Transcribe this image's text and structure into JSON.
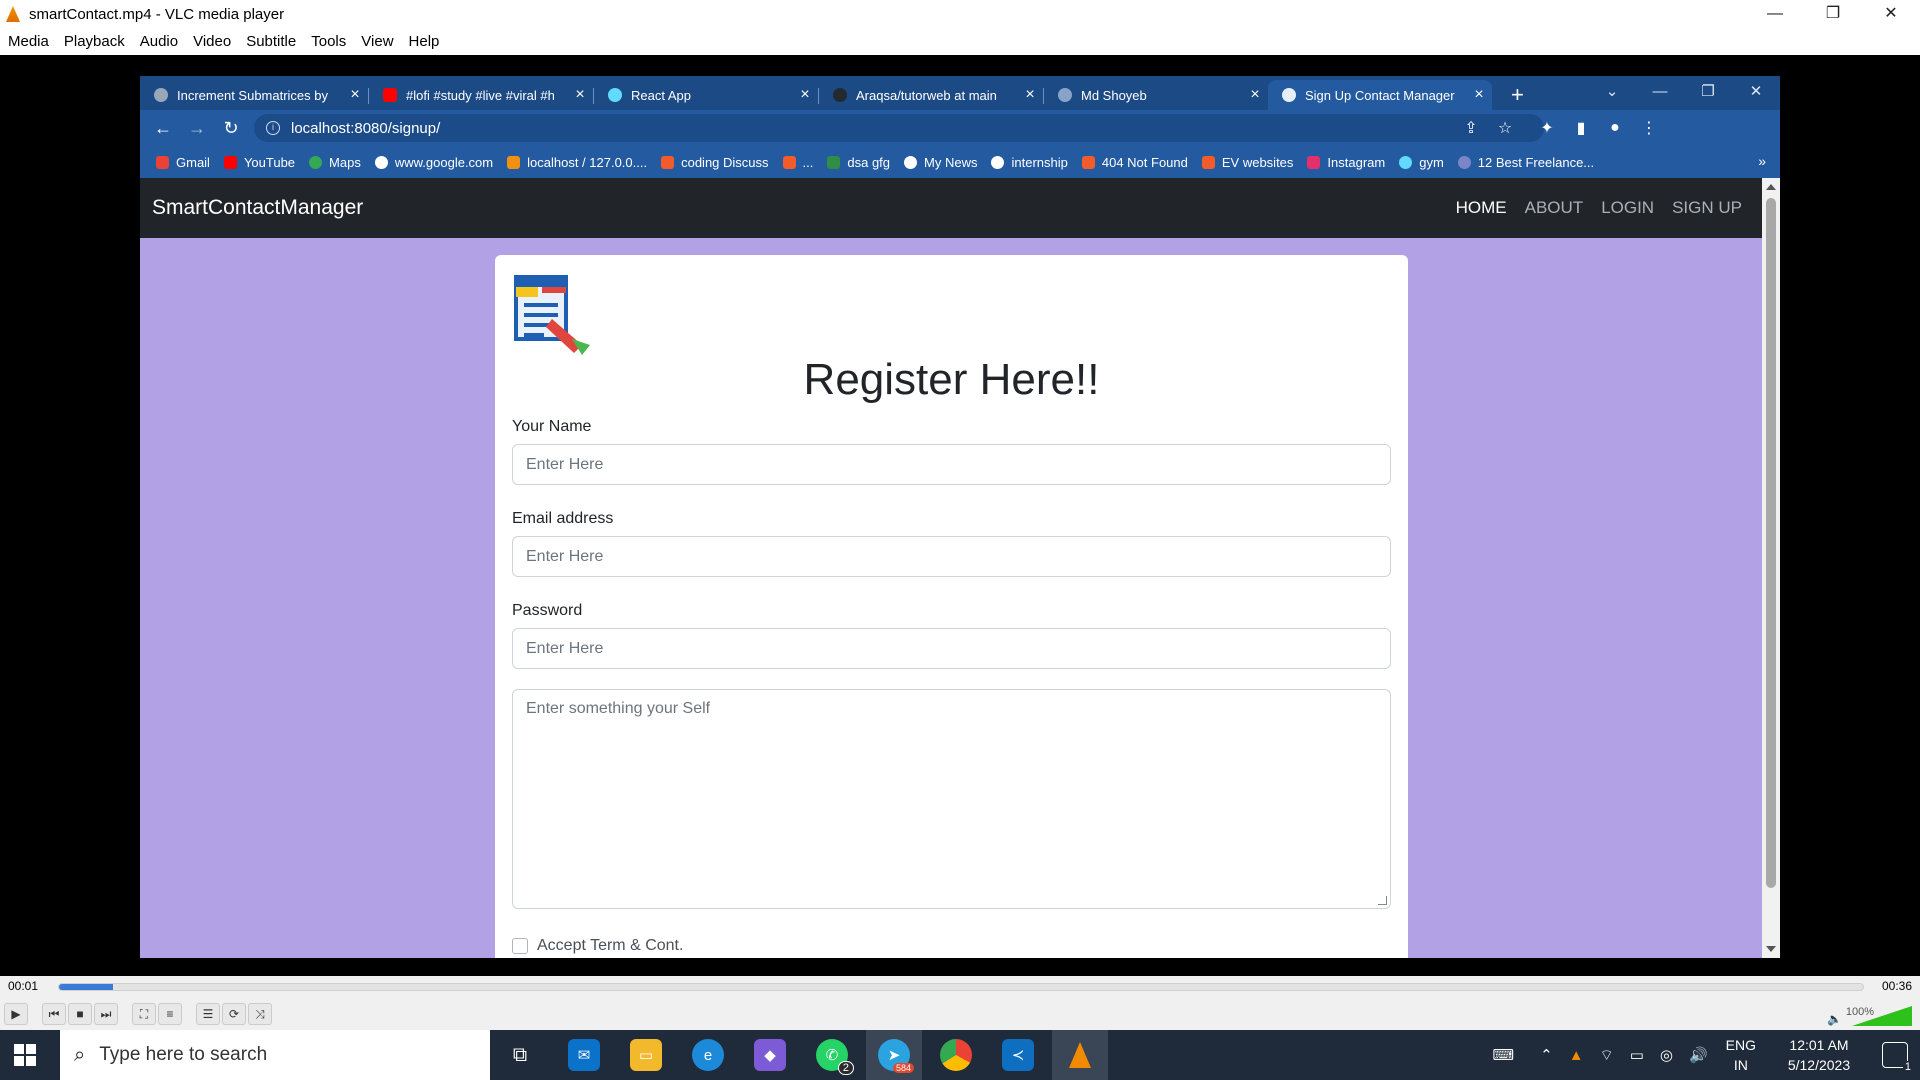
{
  "vlc": {
    "title": "smartContact.mp4 - VLC media player",
    "menu": [
      "Media",
      "Playback",
      "Audio",
      "Video",
      "Subtitle",
      "Tools",
      "View",
      "Help"
    ],
    "time_current": "00:01",
    "time_total": "00:36",
    "progress": 0.03,
    "volume_label": "100%",
    "volume": 1.0
  },
  "browser": {
    "tabs": [
      {
        "label": "Increment Submatrices by",
        "color": "#9aa7b8"
      },
      {
        "label": "#lofi #study #live #viral #h",
        "color": "#ff0000"
      },
      {
        "label": "React App",
        "color": "#61dafb"
      },
      {
        "label": "Araqsa/tutorweb at main",
        "color": "#24292f"
      },
      {
        "label": "Md Shoyeb",
        "color": "#88a3c8"
      },
      {
        "label": "Sign Up Contact Manager",
        "color": "#e8eef8"
      }
    ],
    "url": "localhost:8080/signup/",
    "bookmarks": [
      {
        "label": "Gmail",
        "color": "#ea4335"
      },
      {
        "label": "YouTube",
        "color": "#ff0000"
      },
      {
        "label": "Maps",
        "color": "#34a853"
      },
      {
        "label": "www.google.com",
        "color": "#ffffff"
      },
      {
        "label": "localhost / 127.0.0....",
        "color": "#f29111"
      },
      {
        "label": "coding Discuss",
        "color": "#f25c2a"
      },
      {
        "label": "...",
        "color": "#f25c2a"
      },
      {
        "label": "dsa gfg",
        "color": "#2f8d46"
      },
      {
        "label": "My News",
        "color": "#ffffff"
      },
      {
        "label": "internship",
        "color": "#ffffff"
      },
      {
        "label": "404 Not Found",
        "color": "#f25c2a"
      },
      {
        "label": "EV websites",
        "color": "#f25c2a"
      },
      {
        "label": "Instagram",
        "color": "#e1306c"
      },
      {
        "label": "gym",
        "color": "#61dafb"
      },
      {
        "label": "12 Best Freelance...",
        "color": "#7a86c7"
      }
    ]
  },
  "site": {
    "brand": "SmartContactManager",
    "nav": [
      "HOME",
      "ABOUT",
      "LOGIN",
      "SIGN UP"
    ],
    "title": "Register Here!!",
    "name_label": "Your Name",
    "name_placeholder": "Enter Here",
    "email_label": "Email address",
    "email_placeholder": "Enter Here",
    "password_label": "Password",
    "password_placeholder": "Enter Here",
    "about_placeholder": "Enter something your Self",
    "accept_label": "Accept Term & Cont."
  },
  "taskbar": {
    "search_placeholder": "Type here to search",
    "telegram_badge": "584",
    "whatsapp_badge": "2",
    "lang_top": "ENG",
    "lang_bottom": "IN",
    "time": "12:01 AM",
    "date": "5/12/2023",
    "notifications": "1"
  },
  "colors": {
    "page_bg": "#b3a1e6",
    "navbar": "#212529",
    "chrome_frame": "#235aa0"
  }
}
